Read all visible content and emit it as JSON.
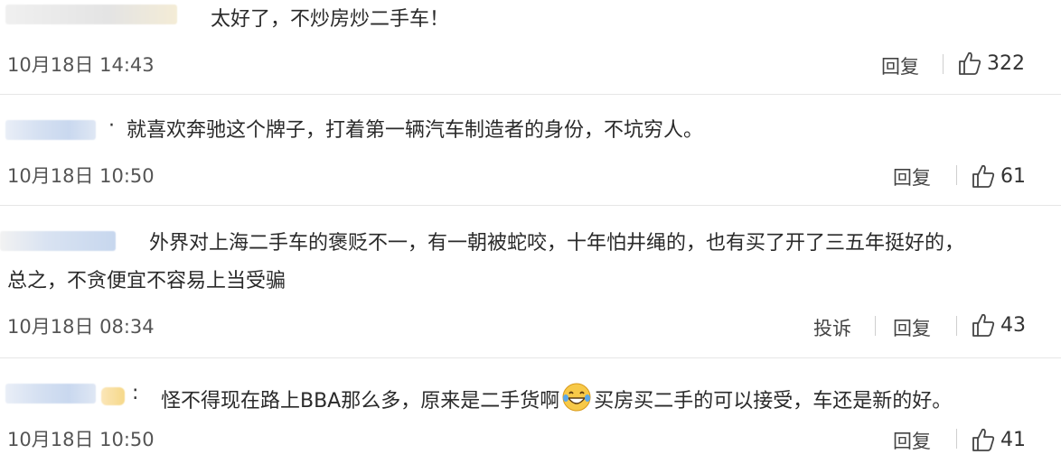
{
  "comments": [
    {
      "text": "太好了，不炒房炒二手车！",
      "time": "10月18日 14:43",
      "reply": "回复",
      "likes": "322"
    },
    {
      "text": "就喜欢奔驰这个牌子，打着第一辆汽车制造者的身份，不坑穷人。",
      "time": "10月18日 10:50",
      "reply": "回复",
      "likes": "61"
    },
    {
      "text": "外界对上海二手车的褒贬不一，有一朝被蛇咬，十年怕井绳的，也有买了开了三五年挺好的，",
      "text2": "总之，不贪便宜不容易上当受骗",
      "time": "10月18日 08:34",
      "report": "投诉",
      "reply": "回复",
      "likes": "43"
    },
    {
      "text_a": "怪不得现在路上BBA那么多，原来是二手货啊",
      "text_b": "买房买二手的可以接受，车还是新的好。",
      "emoji": "laughing-tears-emoji",
      "time": "10月18日 10:50",
      "reply": "回复",
      "likes": "41"
    }
  ],
  "colors": {
    "divider": "#e6e6e6",
    "text": "#2a2a2a",
    "meta": "#555555"
  }
}
